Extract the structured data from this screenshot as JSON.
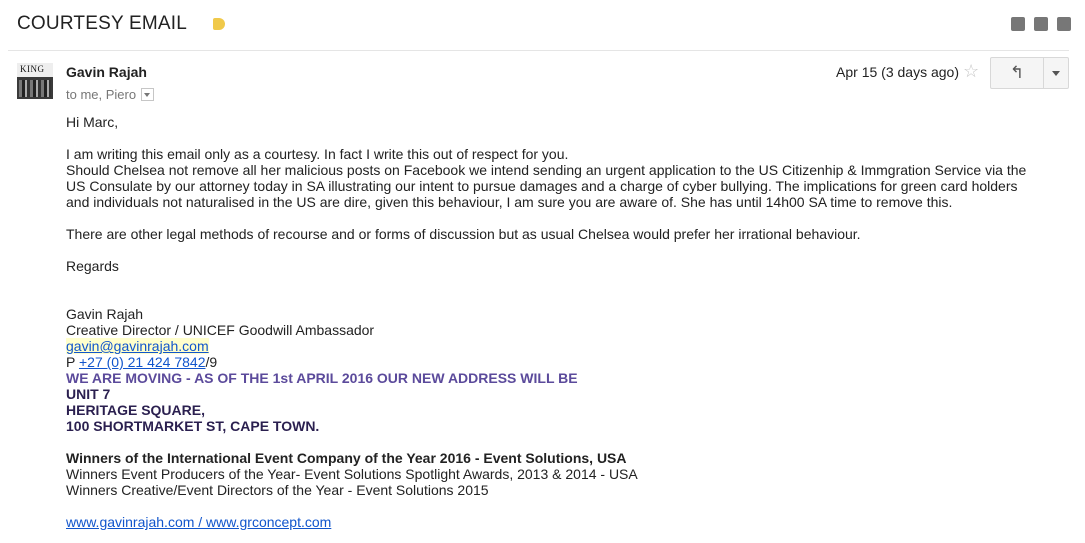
{
  "header": {
    "subject": "COURTESY EMAIL",
    "label_color": "#f0c94a",
    "icons": [
      "archive-icon",
      "print-icon",
      "new-window-icon"
    ]
  },
  "message": {
    "sender": "Gavin Rajah",
    "avatar_text": "KING",
    "recipients": "to me, Piero",
    "date": "Apr 15 (3 days ago)",
    "star_glyph": "☆",
    "reply_glyph": "↰",
    "body": {
      "greeting": "Hi Marc,",
      "para1": [
        "I am writing this email only as a courtesy. In fact I write this out of respect for you.",
        "Should Chelsea not remove all her malicious posts on Facebook we intend sending an urgent application to the US Citizenhip & Immgration Service via the",
        "US Consulate by our attorney today in SA illustrating our intent to pursue damages and a charge of cyber bullying. The implications for green card holders",
        "and individuals not naturalised in the US are dire, given this behaviour, I am sure you are aware of. She has until 14h00 SA time to remove this."
      ],
      "para2": "There are other legal methods of recourse and or forms of discussion but as usual Chelsea would prefer her irrational behaviour.",
      "closing": "Regards"
    },
    "signature": {
      "name": "Gavin Rajah",
      "title": "Creative Director / UNICEF Goodwill Ambassador",
      "email": "gavin@gavinrajah.com",
      "phone_prefix": "P ",
      "phone": "+27 (0) 21 424 7842",
      "phone_suffix": "/9",
      "moving_notice": "WE ARE MOVING - AS OF THE 1st APRIL 2016 OUR NEW ADDRESS WILL BE",
      "address_line1": "UNIT 7",
      "address_line2": "HERITAGE SQUARE,",
      "address_line3": "100 SHORTMARKET ST, CAPE TOWN.",
      "award1": "Winners of the International Event Company of the Year 2016 - Event Solutions, USA",
      "award2": "Winners Event Producers of the Year- Event Solutions Spotlight Awards, 2013 & 2014 - USA",
      "award3": "Winners Creative/Event Directors of the Year - Event Solutions 2015",
      "websites": "www.gavinrajah.com / www.grconcept.com "
    }
  }
}
